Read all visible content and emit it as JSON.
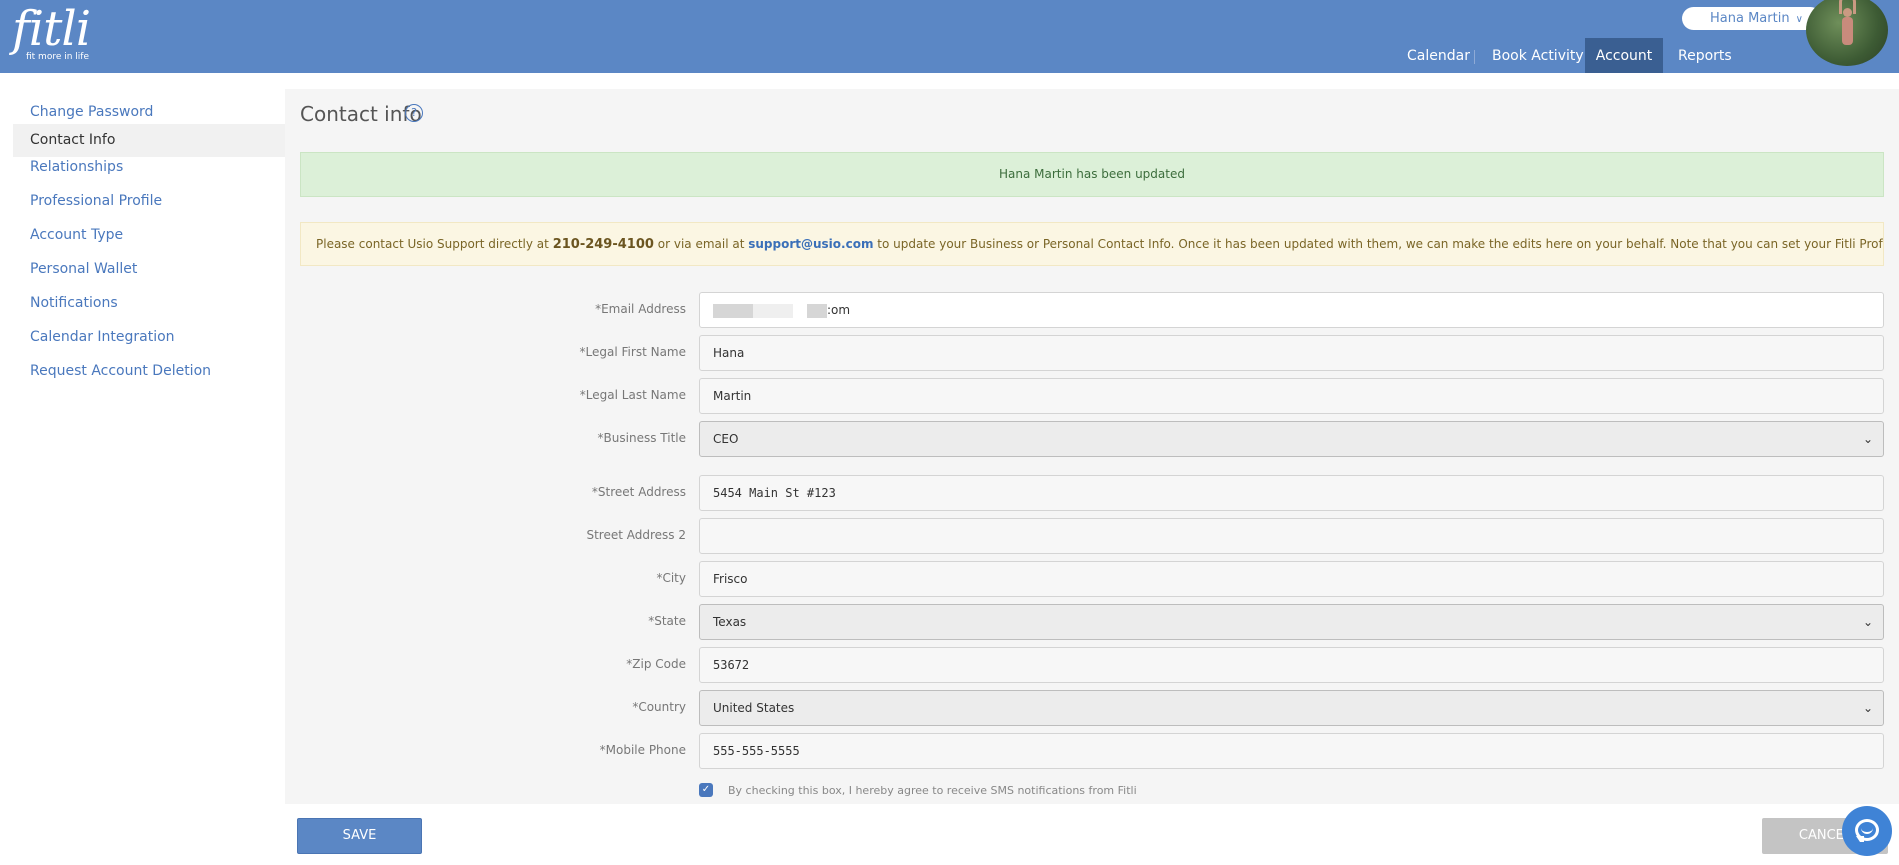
{
  "header": {
    "logo_word": "fitli",
    "logo_tagline": "fit more in life",
    "user_name": "Hana Martin",
    "user_menu_icon": "double-chevron-down-icon",
    "nav": [
      {
        "label": "Calendar"
      },
      {
        "label": "Book Activity"
      },
      {
        "label": "Account",
        "active": true
      },
      {
        "label": "Reports"
      }
    ]
  },
  "sidebar": {
    "items": [
      {
        "label": "Change Password"
      },
      {
        "label": "Contact Info",
        "active": true
      },
      {
        "label": "Relationships"
      },
      {
        "label": "Professional Profile"
      },
      {
        "label": "Account Type"
      },
      {
        "label": "Personal Wallet"
      },
      {
        "label": "Notifications"
      },
      {
        "label": "Calendar Integration"
      },
      {
        "label": "Request Account Deletion"
      }
    ]
  },
  "main": {
    "title": "Contact info",
    "help_icon": "?",
    "success_message": "Hana Martin has been updated",
    "info_message": {
      "part1": "Please contact Usio Support directly at ",
      "phone": "210-249-4100",
      "part2": " or via email at ",
      "email": "support@usio.com",
      "part3": " to update your Business or Personal Contact Info. Once it has been updated with them, we can make the edits here on your behalf. Note that you can set your Fitli Professional or Business Profile to whatever you like."
    },
    "form": {
      "email": {
        "label": "*Email Address",
        "value_suffix": ":om"
      },
      "first_name": {
        "label": "*Legal First Name",
        "value": "Hana"
      },
      "last_name": {
        "label": "*Legal Last Name",
        "value": "Martin"
      },
      "business_title": {
        "label": "*Business Title",
        "value": "CEO"
      },
      "street": {
        "label": "*Street Address",
        "value": "5454 Main St #123"
      },
      "street2": {
        "label": "Street Address 2",
        "value": ""
      },
      "city": {
        "label": "*City",
        "value": "Frisco"
      },
      "state": {
        "label": "*State",
        "value": "Texas"
      },
      "zip": {
        "label": "*Zip Code",
        "value": "53672"
      },
      "country": {
        "label": "*Country",
        "value": "United States"
      },
      "mobile": {
        "label": "*Mobile Phone",
        "value": "555-555-5555"
      },
      "sms_consent": {
        "label": "By checking this box, I hereby agree to receive SMS notifications from Fitli",
        "checked": true
      }
    }
  },
  "footer": {
    "save_label": "SAVE",
    "cancel_label": "CANCEL"
  },
  "colors": {
    "brand": "#5b87c5",
    "nav_active": "#3a5f92",
    "link": "#4a78bd",
    "success_bg": "#dcf0d8",
    "info_bg": "#fbf6e3"
  }
}
